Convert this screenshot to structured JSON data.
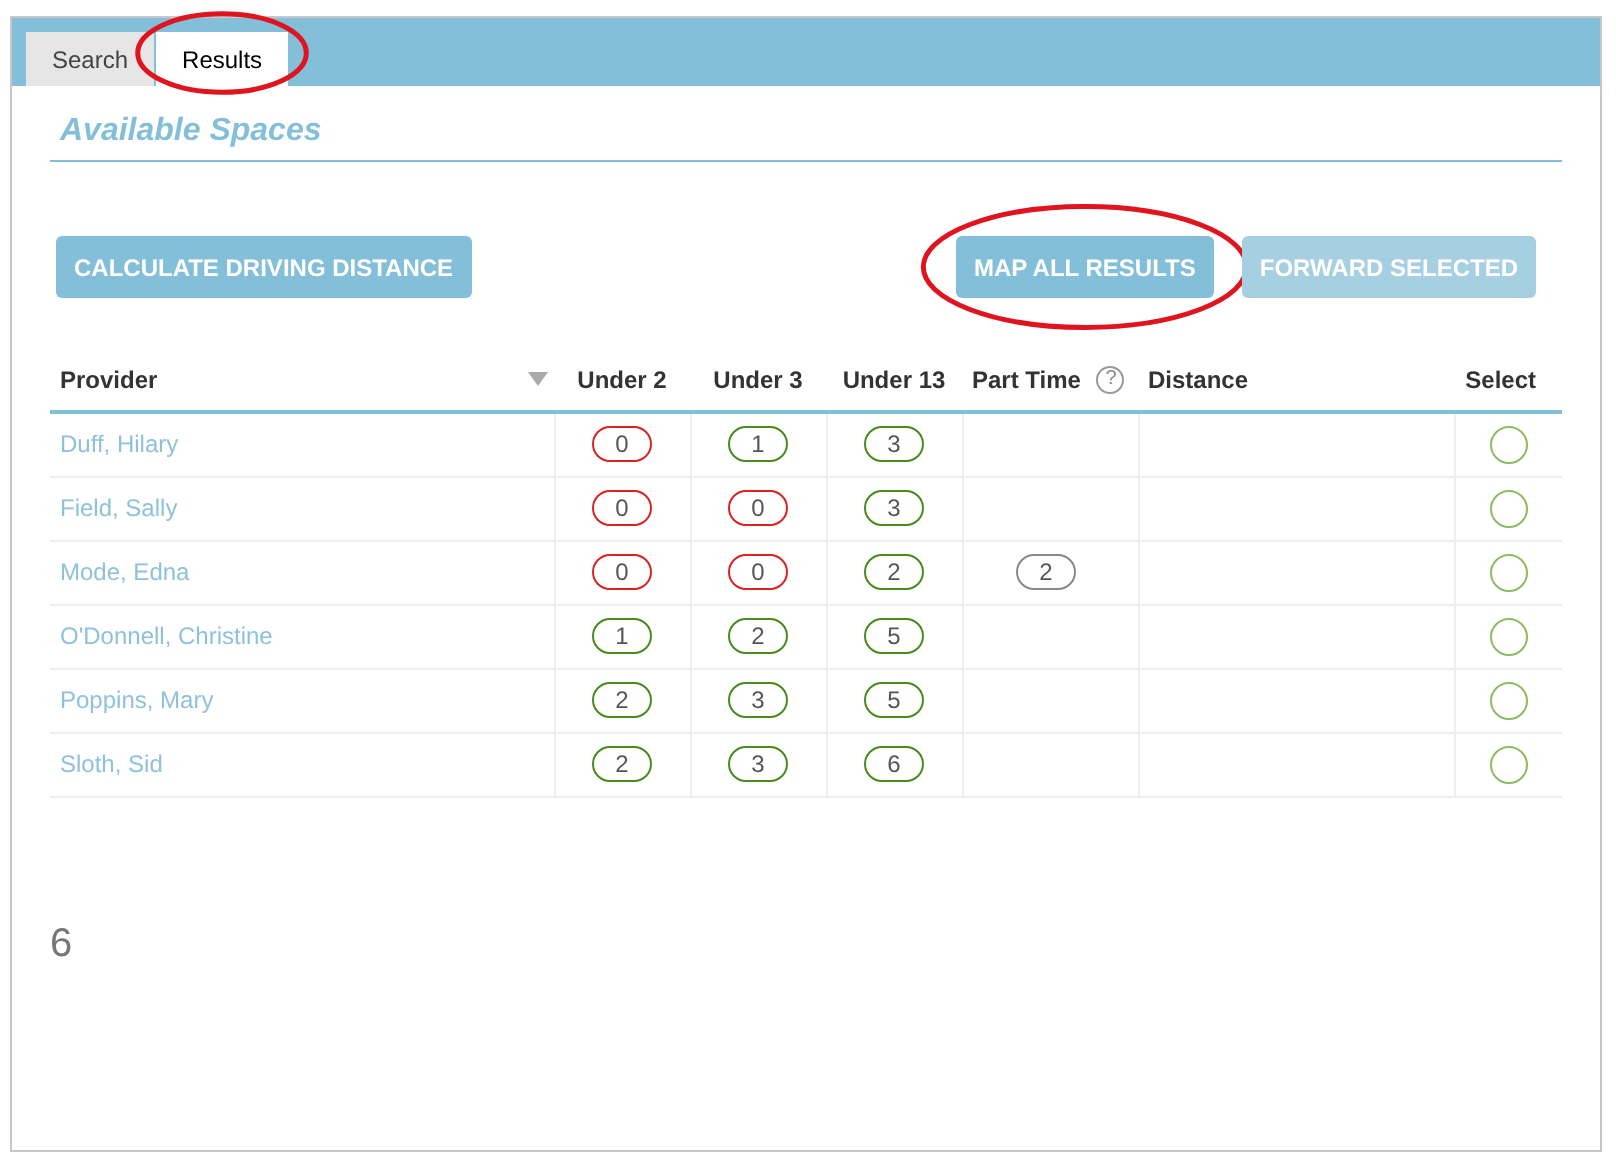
{
  "tabs": [
    {
      "label": "Search",
      "selected": false,
      "highlighted": false
    },
    {
      "label": "Results",
      "selected": true,
      "highlighted": true
    }
  ],
  "heading": "Available Spaces",
  "buttons": [
    {
      "label": "CALCULATE DRIVING DISTANCE",
      "disabled": false,
      "highlighted": false
    },
    {
      "label": "MAP ALL RESULTS",
      "disabled": false,
      "highlighted": true
    },
    {
      "label": "FORWARD SELECTED",
      "disabled": true,
      "highlighted": false
    }
  ],
  "table": {
    "columns": [
      "Provider",
      "Under 2",
      "Under 3",
      "Under 13",
      "Part Time",
      "Distance",
      "Select"
    ],
    "rows": [
      {
        "provider": "Duff, Hilary",
        "under_2": {
          "value": "0",
          "color": "#dd2222"
        },
        "under_3": {
          "value": "1",
          "color": "#4a8a1c"
        },
        "under_13": {
          "value": "3",
          "color": "#4a8a1c"
        },
        "selected": false
      },
      {
        "provider": "Field, Sally",
        "under_2": {
          "value": "0",
          "color": "#dd2222"
        },
        "under_3": {
          "value": "0",
          "color": "#dd2222"
        },
        "under_13": {
          "value": "3",
          "color": "#4a8a1c"
        },
        "selected": false
      },
      {
        "provider": "Mode, Edna",
        "under_2": {
          "value": "0",
          "color": "#dd2222"
        },
        "under_3": {
          "value": "0",
          "color": "#dd2222"
        },
        "under_13": {
          "value": "2",
          "color": "#4a8a1c"
        },
        "part_time": {
          "value": "2",
          "color": "#888888"
        },
        "selected": false
      },
      {
        "provider": "O'Donnell, Christine",
        "under_2": {
          "value": "1",
          "color": "#4a8a1c"
        },
        "under_3": {
          "value": "2",
          "color": "#4a8a1c"
        },
        "under_13": {
          "value": "5",
          "color": "#4a8a1c"
        },
        "selected": false
      },
      {
        "provider": "Poppins, Mary",
        "under_2": {
          "value": "2",
          "color": "#4a8a1c"
        },
        "under_3": {
          "value": "3",
          "color": "#4a8a1c"
        },
        "under_13": {
          "value": "5",
          "color": "#4a8a1c"
        },
        "selected": false
      },
      {
        "provider": "Sloth, Sid",
        "under_2": {
          "value": "2",
          "color": "#4a8a1c"
        },
        "under_3": {
          "value": "3",
          "color": "#4a8a1c"
        },
        "under_13": {
          "value": "6",
          "color": "#4a8a1c"
        },
        "selected": false
      }
    ]
  },
  "part_time_help": "?",
  "result_count": "6"
}
